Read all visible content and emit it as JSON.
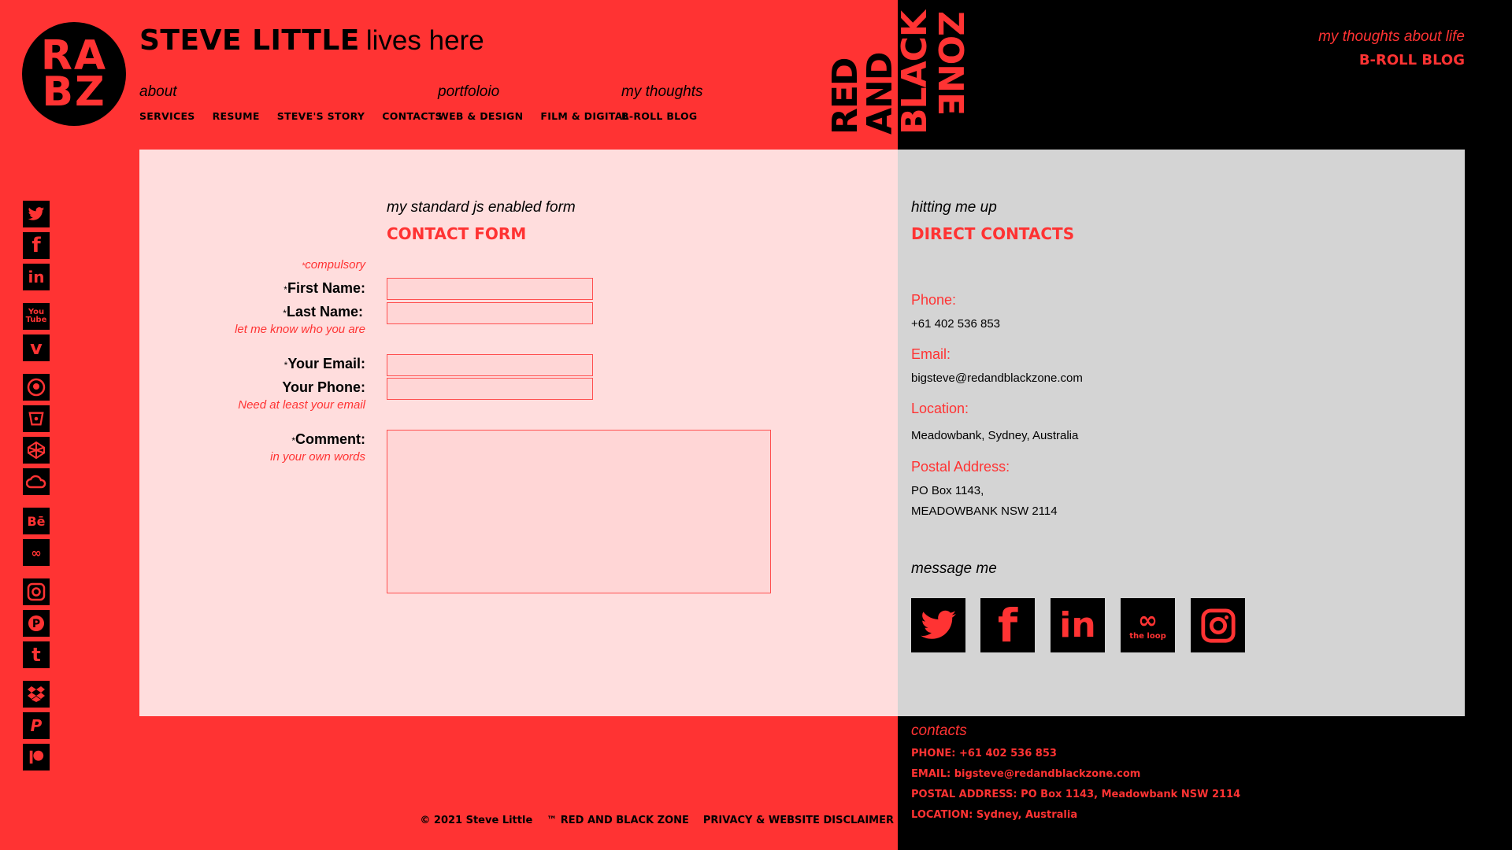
{
  "logo": {
    "line1": "RA",
    "line2": "BZ"
  },
  "header": {
    "name": "STEVE LITTLE",
    "tagline": "lives here"
  },
  "nav": {
    "about": {
      "label": "about",
      "items": [
        "SERVICES",
        "RESUME",
        "STEVE'S STORY",
        "CONTACTS"
      ]
    },
    "portfolio": {
      "label": "portfoloio",
      "items": [
        "WEB & DESIGN",
        "FILM & DIGITAL"
      ]
    },
    "thoughts": {
      "label": "my thoughts",
      "items": [
        "B-ROLL BLOG"
      ]
    }
  },
  "brand": {
    "word1": "RED",
    "word2": "AND",
    "word3": "BLACK",
    "word4": "ZONE"
  },
  "top_right": {
    "subtitle": "my thoughts about life",
    "link": "B-ROLL BLOG"
  },
  "social_left": [
    {
      "icon": "twitter-icon",
      "glyph": "🐦"
    },
    {
      "icon": "facebook-icon",
      "glyph": "f"
    },
    {
      "icon": "linkedin-icon",
      "glyph": "in"
    },
    {
      "icon": "youtube-icon",
      "glyph": "▶"
    },
    {
      "icon": "vimeo-icon",
      "glyph": "v"
    },
    {
      "icon": "github-icon",
      "glyph": "⌾"
    },
    {
      "icon": "bitbucket-icon",
      "glyph": "◎"
    },
    {
      "icon": "codepen-icon",
      "glyph": "◇"
    },
    {
      "icon": "cloud-icon",
      "glyph": "☁"
    },
    {
      "icon": "behance-icon",
      "glyph": "Bē"
    },
    {
      "icon": "the-loop-icon",
      "glyph": "∞"
    },
    {
      "icon": "instagram-icon",
      "glyph": "◉"
    },
    {
      "icon": "pinterest-icon",
      "glyph": "P"
    },
    {
      "icon": "tumblr-icon",
      "glyph": "t"
    },
    {
      "icon": "dropbox-icon",
      "glyph": "❖"
    },
    {
      "icon": "paypal-icon",
      "glyph": "P"
    },
    {
      "icon": "patreon-icon",
      "glyph": "❚●"
    }
  ],
  "form": {
    "subtitle": "my standard js enabled form",
    "title": "CONTACT FORM",
    "compulsory": "compulsory",
    "first_name_label": "First Name:",
    "last_name_label": "Last Name:",
    "name_hint": "let me know who you are",
    "email_label": "Your Email:",
    "phone_label": "Your Phone:",
    "email_hint": "Need at least your email",
    "comment_label": "Comment:",
    "comment_hint": "in your own words",
    "star": "*"
  },
  "contacts": {
    "subtitle": "hitting me up",
    "title": "DIRECT CONTACTS",
    "phone_label": "Phone:",
    "phone": "+61 402 536 853",
    "email_label": "Email:",
    "email": "bigsteve@redandblackzone.com",
    "location_label": "Location:",
    "location": "Meadowbank, Sydney, Australia",
    "postal_label": "Postal Address:",
    "postal_line1": "PO Box 1143,",
    "postal_line2": "MEADOWBANK NSW 2114",
    "message_label": "message me",
    "message_icons": [
      "twitter-icon",
      "facebook-icon",
      "linkedin-icon",
      "the-loop-icon",
      "instagram-icon"
    ],
    "loop_text": "the loop"
  },
  "footer": {
    "copyright": "© 2021 Steve Little",
    "trademark": "™ RED AND BLACK ZONE",
    "disclaimer": "PRIVACY & WEBSITE DISCLAIMER",
    "contacts_label": "contacts",
    "phone": "PHONE: +61 402 536 853",
    "email": "EMAIL: bigsteve@redandblackzone.com",
    "postal": "POSTAL ADDRESS: PO Box 1143, Meadowbank NSW 2114",
    "location": "LOCATION: Sydney, Australia"
  },
  "colors": {
    "accent": "#ff3333",
    "black": "#000000",
    "form_bg": "#ffdddd",
    "contact_bg": "#d4d4d4"
  }
}
